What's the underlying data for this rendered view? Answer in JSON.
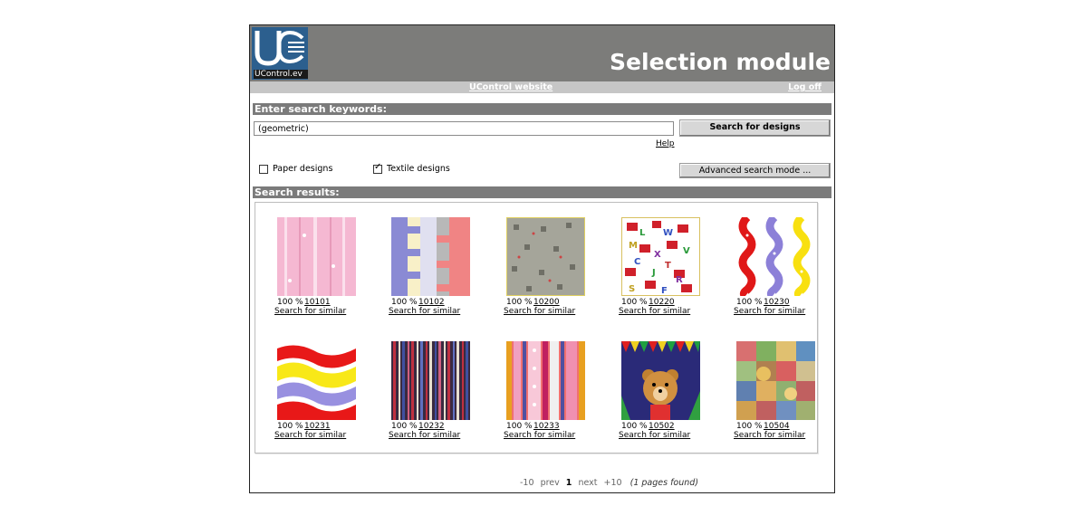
{
  "header": {
    "logo_text": "UControl.ev",
    "title": "Selection module"
  },
  "links": {
    "website": "UControl website",
    "logoff": "Log off"
  },
  "search": {
    "section_label": "Enter search keywords:",
    "query_value": "(geometric)",
    "search_button": "Search for designs",
    "help_link": "Help",
    "paper_label": "Paper designs",
    "paper_checked": false,
    "textile_label": "Textile designs",
    "textile_checked": true,
    "advanced_button": "Advanced search mode ..."
  },
  "results": {
    "section_label": "Search results:",
    "similar_label": "Search for similar",
    "items": [
      {
        "pct": "100 %",
        "code": "10101"
      },
      {
        "pct": "100 %",
        "code": "10102"
      },
      {
        "pct": "100 %",
        "code": "10200"
      },
      {
        "pct": "100 %",
        "code": "10220"
      },
      {
        "pct": "100 %",
        "code": "10230"
      },
      {
        "pct": "100 %",
        "code": "10231"
      },
      {
        "pct": "100 %",
        "code": "10232"
      },
      {
        "pct": "100 %",
        "code": "10233"
      },
      {
        "pct": "100 %",
        "code": "10502"
      },
      {
        "pct": "100 %",
        "code": "10504"
      }
    ]
  },
  "pager": {
    "minus10": "-10",
    "prev": "prev",
    "current": "1",
    "next": "next",
    "plus10": "+10",
    "found": "(1 pages found)"
  }
}
